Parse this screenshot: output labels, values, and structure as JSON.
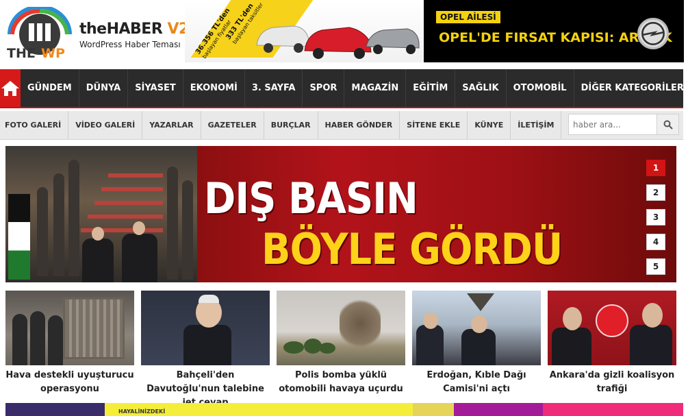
{
  "header": {
    "logo_brand_small": "THE",
    "logo_brand_wp": "WP",
    "logo_title_main": "theHABER",
    "logo_title_version": "V2",
    "logo_subtitle": "WordPress Haber Teması"
  },
  "ad_left": {
    "price1": "36.356 TL'den",
    "price1_note": "başlayan fiyatlar",
    "price2": "333 TL'den",
    "price2_note": "başlayan taksitler"
  },
  "ad_right": {
    "tag": "OPEL AİLESİ",
    "headline": "OPEL'DE FIRSAT KAPISI: ARALIK"
  },
  "main_nav": {
    "items": [
      "GÜNDEM",
      "DÜNYA",
      "SİYASET",
      "EKONOMİ",
      "3. SAYFA",
      "SPOR",
      "MAGAZİN",
      "EĞİTİM",
      "SAĞLIK",
      "OTOMOBİL",
      "DİĞER KATEGORİLER"
    ]
  },
  "sub_nav": {
    "items": [
      "FOTO GALERİ",
      "VİDEO GALERİ",
      "YAZARLAR",
      "GAZETELER",
      "BURÇLAR",
      "HABER GÖNDER",
      "SİTENE EKLE",
      "KÜNYE",
      "İLETİŞİM"
    ]
  },
  "search": {
    "placeholder": "haber ara..."
  },
  "slider": {
    "headline_line1": "DIŞ BASIN",
    "headline_line2": "BÖYLE GÖRDÜ",
    "pages": [
      "1",
      "2",
      "3",
      "4",
      "5"
    ],
    "active_page": "1"
  },
  "cards": [
    {
      "title": "Hava destekli uyuşturucu operasyonu"
    },
    {
      "title": "Bahçeli'den Davutoğlu'nun talebine jet cevap"
    },
    {
      "title": "Polis bomba yüklü otomobili havaya uçurdu"
    },
    {
      "title": "Erdoğan, Kıble Dağı Camisi'ni açtı"
    },
    {
      "title": "Ankara'da gizli koalisyon trafiği"
    }
  ],
  "bottom_ad": {
    "text": "HAYALİNİZDEKİ"
  },
  "colors": {
    "accent_red": "#d61a1a",
    "nav_dark": "#2b2b2b",
    "opel_yellow": "#f5d20f",
    "headline_yellow": "#ffd21a"
  }
}
